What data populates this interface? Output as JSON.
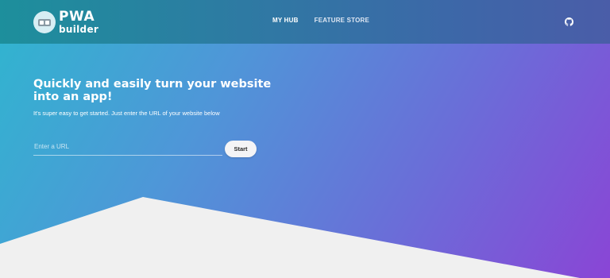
{
  "header": {
    "logo": {
      "line1": "PWA",
      "line2": "builder"
    },
    "nav": [
      {
        "label": "MY HUB",
        "active": true
      },
      {
        "label": "FEATURE STORE",
        "active": false
      }
    ],
    "github_icon": "github-icon"
  },
  "hero": {
    "headline": "Quickly and easily turn your website into an app!",
    "subheadline": "It's super easy to get started. Just enter the URL of your website below",
    "url_input": {
      "placeholder": "Enter a URL",
      "value": ""
    },
    "start_label": "Start"
  },
  "colors": {
    "gradient_start": "#2fb6cf",
    "gradient_end": "#8a45d6",
    "header": "#2e7aa3",
    "page_background": "#f0f0f0"
  }
}
